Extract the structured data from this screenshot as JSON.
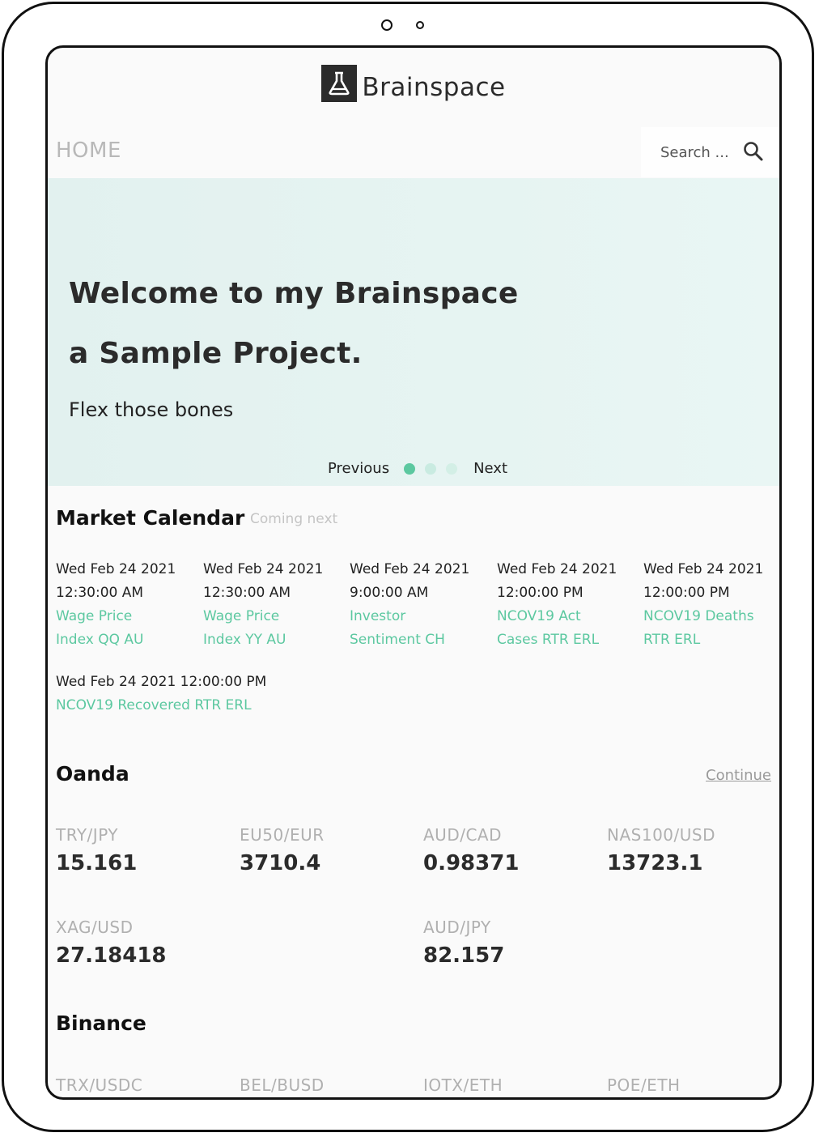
{
  "brand": {
    "name": "Brainspace"
  },
  "nav": {
    "home": "HOME"
  },
  "search": {
    "placeholder": "Search ..."
  },
  "hero": {
    "line1": "Welcome to my Brainspace",
    "line2": "a Sample Project.",
    "subtitle": "Flex those bones",
    "prev": "Previous",
    "next": "Next",
    "active_slide": 1,
    "slide_count": 3
  },
  "calendar": {
    "title": "Market Calendar",
    "subtitle": "Coming next",
    "events": [
      {
        "date": "Wed Feb 24 2021",
        "time": "12:30:00 AM",
        "name1": "Wage Price",
        "name2": "Index QQ AU"
      },
      {
        "date": "Wed Feb 24 2021",
        "time": "12:30:00 AM",
        "name1": "Wage Price",
        "name2": "Index YY AU"
      },
      {
        "date": "Wed Feb 24 2021",
        "time": "9:00:00 AM",
        "name1": "Investor",
        "name2": "Sentiment CH"
      },
      {
        "date": "Wed Feb 24 2021",
        "time": "12:00:00 PM",
        "name1": "NCOV19 Act",
        "name2": "Cases RTR ERL"
      },
      {
        "date": "Wed Feb 24 2021",
        "time": "12:00:00 PM",
        "name1": "NCOV19 Deaths",
        "name2": "RTR ERL"
      },
      {
        "datetime": "Wed Feb 24 2021 12:00:00 PM",
        "name": "NCOV19 Recovered RTR ERL"
      }
    ]
  },
  "oanda": {
    "title": "Oanda",
    "continue": "Continue",
    "pairs": [
      {
        "symbol": "TRY/JPY",
        "price": "15.161"
      },
      {
        "symbol": "EU50/EUR",
        "price": "3710.4"
      },
      {
        "symbol": "AUD/CAD",
        "price": "0.98371"
      },
      {
        "symbol": "NAS100/USD",
        "price": "13723.1"
      },
      {
        "symbol": "XAG/USD",
        "price": "27.18418"
      },
      {
        "symbol": "AUD/JPY",
        "price": "82.157"
      }
    ]
  },
  "binance": {
    "title": "Binance",
    "pairs": [
      {
        "symbol": "TRX/USDC"
      },
      {
        "symbol": "BEL/BUSD"
      },
      {
        "symbol": "IOTX/ETH"
      },
      {
        "symbol": "POE/ETH"
      }
    ]
  },
  "colors": {
    "accent": "#5cc8a0",
    "text": "#2b2b2b",
    "muted": "#b0b0b0",
    "hero_bg": "#e5f3f1"
  },
  "icons": {
    "logo": "flask-icon",
    "search": "search-icon"
  }
}
